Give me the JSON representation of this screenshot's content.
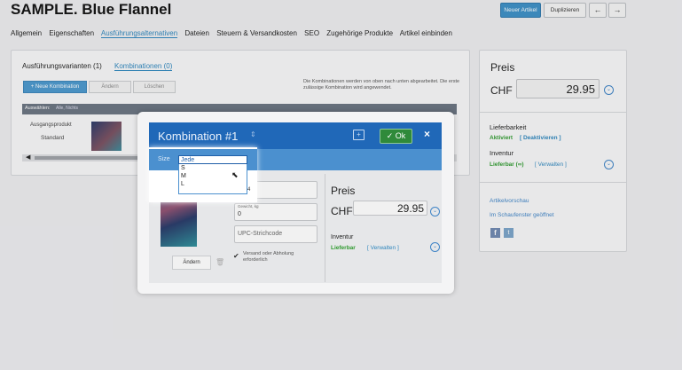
{
  "title": "SAMPLE. Blue Flannel",
  "top_buttons": {
    "new_article": "Neuer Artikel",
    "duplicate": "Duplizieren",
    "prev": "←",
    "next": "→"
  },
  "tabs": [
    "Allgemein",
    "Eigenschaften",
    "Ausführungsalternativen",
    "Dateien",
    "Steuern & Versandkosten",
    "SEO",
    "Zugehörige Produkte",
    "Artikel einbinden"
  ],
  "variants_panel": {
    "tab1": "Ausführungsvarianten (1)",
    "tab2": "Kombinationen (0)",
    "new_btn": "+ Neue Kombination",
    "edit_btn": "Ändern",
    "delete_btn": "Löschen",
    "info": "Die Kombinationen werden von oben nach unten abgearbeitet. Die erste zulässige Kombination wird angewendet.",
    "table_headers": [
      "Auswählen:",
      "Alle, Nichts",
      "Ausführungsvarianten",
      "Art.-Nr.",
      "Gewicht, kg",
      "Lagerbestand",
      "Preis, CHF"
    ],
    "row_label": "Ausgangsprodukt",
    "row_value": "Standard"
  },
  "right_panel": {
    "price_label": "Preis",
    "currency": "CHF",
    "price": "29.95",
    "availability_label": "Lieferbarkeit",
    "availability_status": "Aktiviert",
    "availability_action": "[ Deaktivieren ]",
    "inventory_label": "Inventur",
    "inventory_status": "Lieferbar (∞)",
    "inventory_action": "[ Verwalten ]",
    "link_preview": "Artikelvorschau",
    "link_store": "Im Schaufenster geöffnet"
  },
  "modal": {
    "title": "Kombination #1",
    "ok": "Ok",
    "close": "×",
    "size_label": "Size",
    "select_value": "Jede",
    "options": [
      "S",
      "M",
      "L"
    ],
    "sku_value": "4",
    "weight_label": "Gewicht, kg",
    "weight_value": "0",
    "upc_placeholder": "UPC-Strichcode",
    "shipping_label": "Versand oder Abholung erforderlich",
    "edit_btn": "Ändern",
    "price_label": "Preis",
    "currency": "CHF",
    "price": "29.95",
    "inventory_label": "Inventur",
    "inventory_status": "Lieferbar",
    "inventory_action": "[ Verwalten ]"
  },
  "colors": {
    "accent": "#2e86bd",
    "modal_header": "#2068b8",
    "modal_bar": "#4b90cf",
    "green": "#2f9a2f"
  }
}
